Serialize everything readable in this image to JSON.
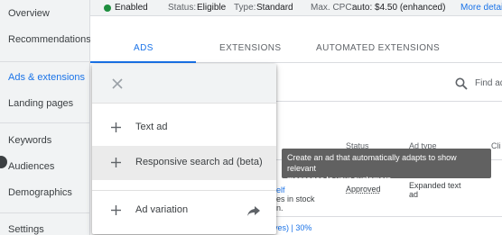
{
  "sidebar": {
    "items": [
      {
        "label": "Overview"
      },
      {
        "label": "Recommendations"
      },
      {
        "label": "Ads & extensions"
      },
      {
        "label": "Landing pages"
      },
      {
        "label": "Keywords"
      },
      {
        "label": "Audiences"
      },
      {
        "label": "Demographics"
      },
      {
        "label": "Settings"
      }
    ]
  },
  "status_bar": {
    "status": "Enabled",
    "status_label": "Status:",
    "status_value": "Eligible",
    "type_label": "Type:",
    "type_value": "Standard",
    "cpc_label": "Max. CPC:",
    "cpc_value": "auto: $4.50 (enhanced)",
    "more_details": "More detai"
  },
  "tabs": [
    {
      "label": "ADS"
    },
    {
      "label": "EXTENSIONS"
    },
    {
      "label": "AUTOMATED EXTENSIONS"
    }
  ],
  "search": {
    "placeholder": "Find ad"
  },
  "table": {
    "headers": [
      "Status",
      "Ad type",
      "Cli"
    ],
    "row": {
      "fragment1": "elf",
      "fragment2": "es in stock",
      "fragment3": "n.",
      "status": "Approved",
      "ad_type_line1": "Expanded text",
      "ad_type_line2": "ad"
    },
    "footer_fragment": "ves) | 30%"
  },
  "menu": {
    "items": [
      {
        "label": "Text ad"
      },
      {
        "label": "Responsive search ad (beta)"
      },
      {
        "label": "Ad variation"
      }
    ]
  },
  "tooltip": {
    "line1": "Create an ad that automatically adapts to show relevant",
    "line2": "messages to your customers"
  },
  "colors": {
    "accent": "#1a73e8",
    "enabled_green": "#1e8e3e",
    "tooltip_bg": "#616161"
  }
}
